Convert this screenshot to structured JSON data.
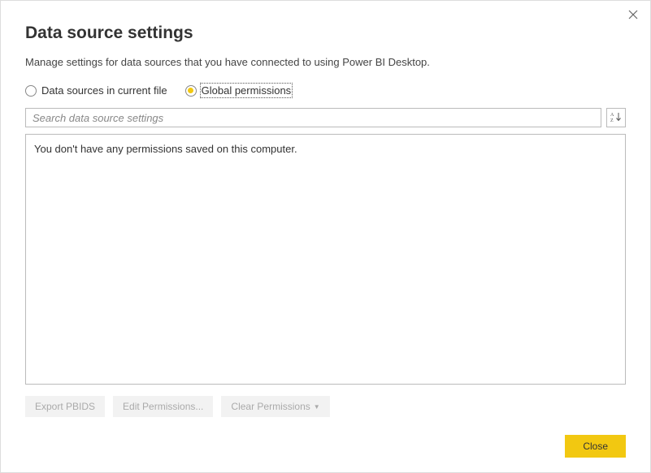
{
  "dialog": {
    "title": "Data source settings",
    "subtitle": "Manage settings for data sources that you have connected to using Power BI Desktop."
  },
  "scope": {
    "option_current_file": "Data sources in current file",
    "option_global": "Global permissions",
    "selected": "global"
  },
  "search": {
    "placeholder": "Search data source settings",
    "sort_icon": "sort-az"
  },
  "list": {
    "empty_message": "You don't have any permissions saved on this computer."
  },
  "actions": {
    "export_pbids": "Export PBIDS",
    "edit_permissions": "Edit Permissions...",
    "clear_permissions": "Clear Permissions",
    "close": "Close"
  }
}
